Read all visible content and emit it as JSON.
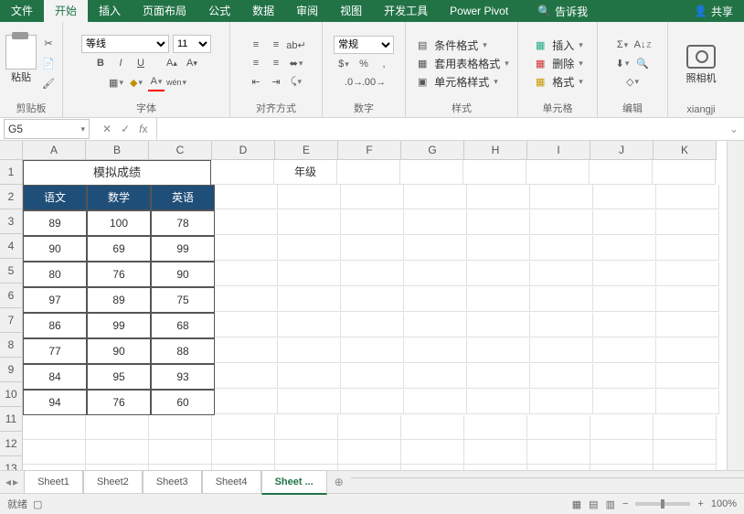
{
  "titlebar": {
    "tabs": [
      "文件",
      "开始",
      "插入",
      "页面布局",
      "公式",
      "数据",
      "审阅",
      "视图",
      "开发工具",
      "Power Pivot"
    ],
    "active_tab": 1,
    "tellme": "告诉我",
    "share": "共享"
  },
  "ribbon": {
    "clipboard": {
      "label": "剪贴板",
      "paste": "粘贴"
    },
    "font": {
      "label": "字体",
      "name": "等线",
      "size": "11"
    },
    "align": {
      "label": "对齐方式"
    },
    "number": {
      "label": "数字",
      "format": "常规"
    },
    "styles": {
      "label": "样式",
      "cond": "条件格式",
      "table": "套用表格格式",
      "cell": "单元格样式"
    },
    "cells": {
      "label": "单元格",
      "insert": "插入",
      "delete": "删除",
      "format": "格式"
    },
    "edit": {
      "label": "编辑"
    },
    "camera": {
      "label": "照相机",
      "group": "xiangji"
    }
  },
  "namebox": {
    "ref": "G5"
  },
  "columns": [
    "A",
    "B",
    "C",
    "D",
    "E",
    "F",
    "G",
    "H",
    "I",
    "J",
    "K"
  ],
  "rows": [
    1,
    2,
    3,
    4,
    5,
    6,
    7,
    8,
    9,
    10,
    11,
    12,
    13
  ],
  "sheet": {
    "title": "模拟成绩",
    "e1": "年级",
    "headers": [
      "语文",
      "数学",
      "英语"
    ],
    "data": [
      [
        89,
        100,
        78
      ],
      [
        90,
        69,
        99
      ],
      [
        80,
        76,
        90
      ],
      [
        97,
        89,
        75
      ],
      [
        86,
        99,
        68
      ],
      [
        77,
        90,
        88
      ],
      [
        84,
        95,
        93
      ],
      [
        94,
        76,
        60
      ]
    ]
  },
  "tabs": {
    "list": [
      "Sheet1",
      "Sheet2",
      "Sheet3",
      "Sheet4",
      "Sheet ..."
    ],
    "active": 4,
    "new": "⊕"
  },
  "status": {
    "ready": "就绪",
    "zoom": "100%"
  },
  "chart_data": {
    "type": "table",
    "title": "模拟成绩",
    "columns": [
      "语文",
      "数学",
      "英语"
    ],
    "rows": [
      [
        89,
        100,
        78
      ],
      [
        90,
        69,
        99
      ],
      [
        80,
        76,
        90
      ],
      [
        97,
        89,
        75
      ],
      [
        86,
        99,
        68
      ],
      [
        77,
        90,
        88
      ],
      [
        84,
        95,
        93
      ],
      [
        94,
        76,
        60
      ]
    ]
  }
}
